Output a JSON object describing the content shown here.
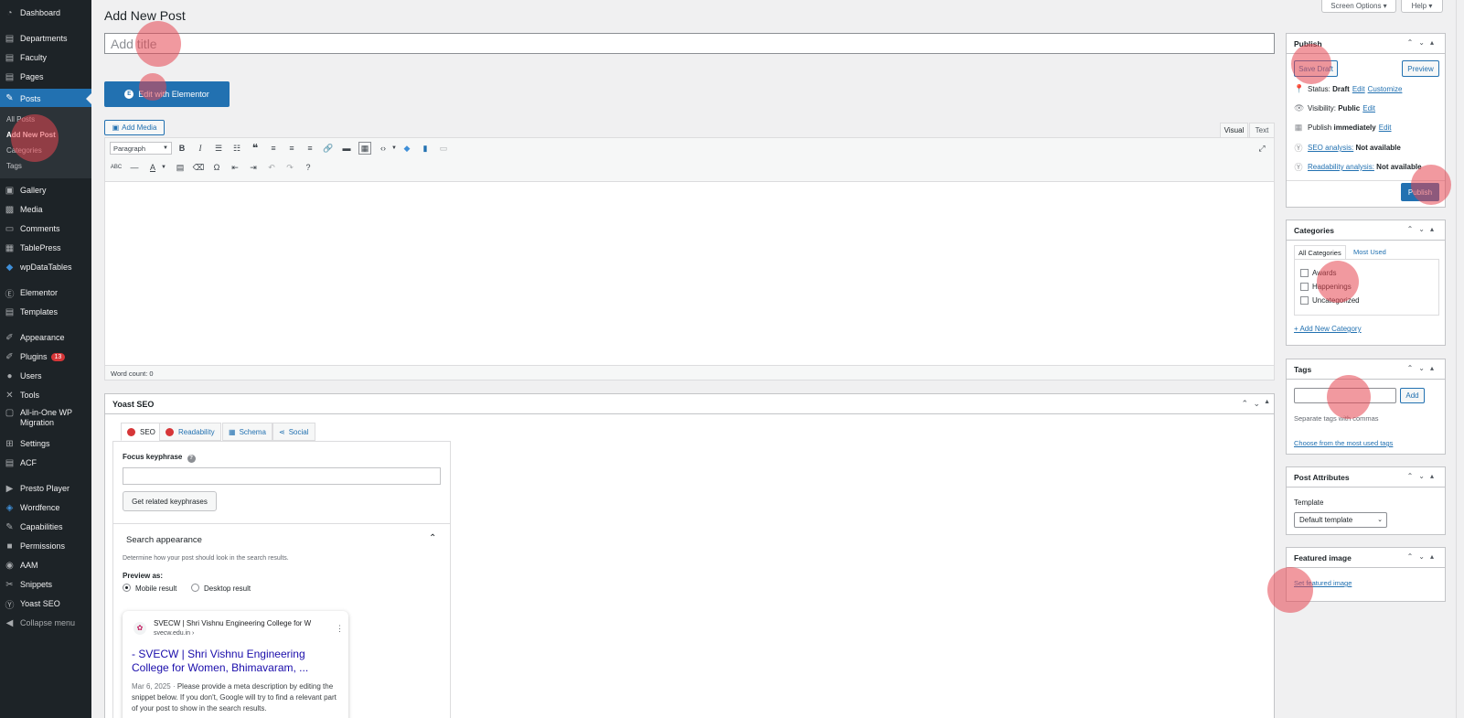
{
  "sidebar": {
    "items": [
      {
        "label": "Dashboard",
        "icon": "dashboard-icon",
        "glyph": "◔"
      },
      {
        "label": "Departments",
        "icon": "pushpin-icon",
        "glyph": "▤"
      },
      {
        "label": "Faculty",
        "icon": "pushpin-icon",
        "glyph": "▤"
      },
      {
        "label": "Pages",
        "icon": "pages-icon",
        "glyph": "▤"
      },
      {
        "label": "Posts",
        "icon": "pushpin-icon",
        "glyph": "✎"
      },
      {
        "label": "Gallery",
        "icon": "gallery-icon",
        "glyph": "▣"
      },
      {
        "label": "Media",
        "icon": "media-icon",
        "glyph": "▩"
      },
      {
        "label": "Comments",
        "icon": "comments-icon",
        "glyph": "▭"
      },
      {
        "label": "TablePress",
        "icon": "table-icon",
        "glyph": "▦"
      },
      {
        "label": "wpDataTables",
        "icon": "wpdatatables-icon",
        "glyph": "◆"
      },
      {
        "label": "Elementor",
        "icon": "elementor-icon",
        "glyph": "Ⓔ"
      },
      {
        "label": "Templates",
        "icon": "templates-icon",
        "glyph": "▤"
      },
      {
        "label": "Appearance",
        "icon": "brush-icon",
        "glyph": "✐"
      },
      {
        "label": "Plugins",
        "icon": "plugins-icon",
        "glyph": "✐",
        "badge": "13"
      },
      {
        "label": "Users",
        "icon": "users-icon",
        "glyph": "●"
      },
      {
        "label": "Tools",
        "icon": "tools-icon",
        "glyph": "✕"
      },
      {
        "label": "All-in-One WP",
        "label2": "Migration",
        "icon": "migration-icon",
        "glyph": "▢"
      },
      {
        "label": "Settings",
        "icon": "settings-icon",
        "glyph": "⊞"
      },
      {
        "label": "ACF",
        "icon": "acf-icon",
        "glyph": "▤"
      },
      {
        "label": "Presto Player",
        "icon": "presto-icon",
        "glyph": "▶"
      },
      {
        "label": "Wordfence",
        "icon": "wordfence-icon",
        "glyph": "◈"
      },
      {
        "label": "Capabilities",
        "icon": "capabilities-icon",
        "glyph": "✎"
      },
      {
        "label": "Permissions",
        "icon": "lock-icon",
        "glyph": "■"
      },
      {
        "label": "AAM",
        "icon": "aam-icon",
        "glyph": "◉"
      },
      {
        "label": "Snippets",
        "icon": "snippets-icon",
        "glyph": "✂"
      },
      {
        "label": "Yoast SEO",
        "icon": "yoast-icon",
        "glyph": "Ⓨ"
      },
      {
        "label": "Collapse menu",
        "icon": "collapse-icon",
        "glyph": "◀"
      }
    ],
    "submenu": [
      "All Posts",
      "Add New Post",
      "Categories",
      "Tags"
    ]
  },
  "header": {
    "title": "Add New Post",
    "screen_options": "Screen Options ▾",
    "help": "Help ▾"
  },
  "editor": {
    "title_placeholder": "Add title",
    "elementor_button": "Edit with Elementor",
    "add_media": "Add Media",
    "tabs": [
      "Visual",
      "Text"
    ],
    "format": "Paragraph",
    "word_count": "Word count: 0"
  },
  "yoast": {
    "title": "Yoast SEO",
    "tabs": [
      "SEO",
      "Readability",
      "Schema",
      "Social"
    ],
    "focus_keyphrase": "Focus keyphrase",
    "related_button": "Get related keyphrases",
    "search_appearance": "Search appearance",
    "search_desc": "Determine how your post should look in the search results.",
    "preview_as": "Preview as:",
    "mobile": "Mobile result",
    "desktop": "Desktop result",
    "snippet": {
      "site": "SVECW | Shri Vishnu Engineering College for W",
      "url": "svecw.edu.in ›",
      "title": "- SVECW | Shri Vishnu Engineering College for Women, Bhimavaram, ...",
      "date": "Mar 6, 2025",
      "desc": "Please provide a meta description by editing the snippet below. If you don't, Google will try to find a relevant part of your post to show in the search results."
    }
  },
  "publish": {
    "title": "Publish",
    "save_draft": "Save Draft",
    "preview": "Preview",
    "status_label": "Status:",
    "status_value": "Draft",
    "edit": "Edit",
    "customize": "Customize",
    "visibility_label": "Visibility:",
    "visibility_value": "Public",
    "publish_label": "Publish",
    "publish_value": "immediately",
    "seo_link": "SEO analysis:",
    "seo_value": "Not available",
    "readability_link": "Readability analysis:",
    "readability_value": "Not available",
    "publish_button": "Publish"
  },
  "categories": {
    "title": "Categories",
    "tab_all": "All Categories",
    "tab_used": "Most Used",
    "items": [
      "Awards",
      "Happenings",
      "Uncategorized"
    ],
    "add_new": "+ Add New Category"
  },
  "tags": {
    "title": "Tags",
    "add": "Add",
    "hint": "Separate tags with commas",
    "choose": "Choose from the most used tags"
  },
  "attributes": {
    "title": "Post Attributes",
    "template_label": "Template",
    "template_value": "Default template"
  },
  "featured": {
    "title": "Featured image",
    "set": "Set featured image"
  },
  "colors": {
    "accent": "#2271b1",
    "sidebar": "#1d2327",
    "marker": "#e64650"
  }
}
